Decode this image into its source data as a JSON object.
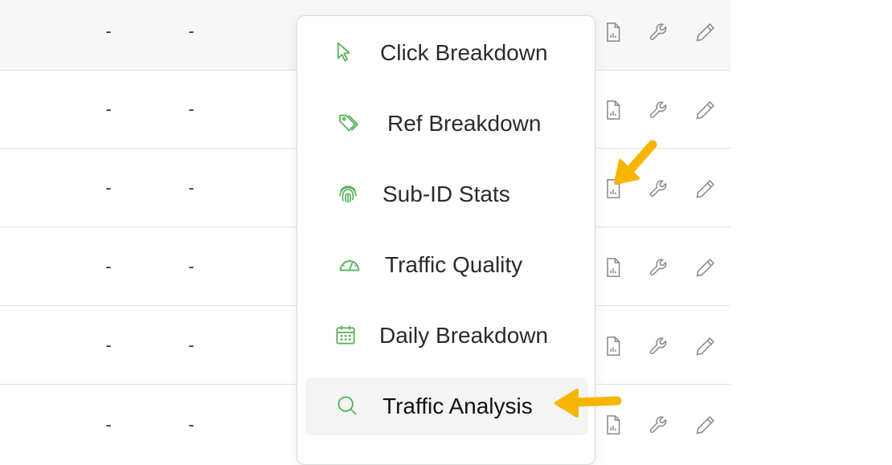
{
  "table": {
    "rows": [
      {
        "col1": "-",
        "col2": "-"
      },
      {
        "col1": "-",
        "col2": "-"
      },
      {
        "col1": "-",
        "col2": "-"
      },
      {
        "col1": "-",
        "col2": "-"
      },
      {
        "col1": "-",
        "col2": "-"
      },
      {
        "col1": "-",
        "col2": "-"
      }
    ],
    "row_actions": [
      "report-icon",
      "wrench-icon",
      "pencil-icon"
    ]
  },
  "dropdown": {
    "items": [
      {
        "label": "Click Breakdown",
        "icon": "cursor-icon"
      },
      {
        "label": "Ref Breakdown",
        "icon": "tags-icon"
      },
      {
        "label": "Sub-ID Stats",
        "icon": "fingerprint-icon"
      },
      {
        "label": "Traffic Quality",
        "icon": "gauge-icon"
      },
      {
        "label": "Daily Breakdown",
        "icon": "calendar-icon"
      },
      {
        "label": "Traffic Analysis",
        "icon": "search-icon"
      }
    ],
    "highlighted": "Traffic Analysis"
  },
  "colors": {
    "icon_green": "#5cb360",
    "icon_gray": "#888888",
    "annotation_arrow": "#f7b500",
    "highlight_bg": "#f4f4f4"
  }
}
